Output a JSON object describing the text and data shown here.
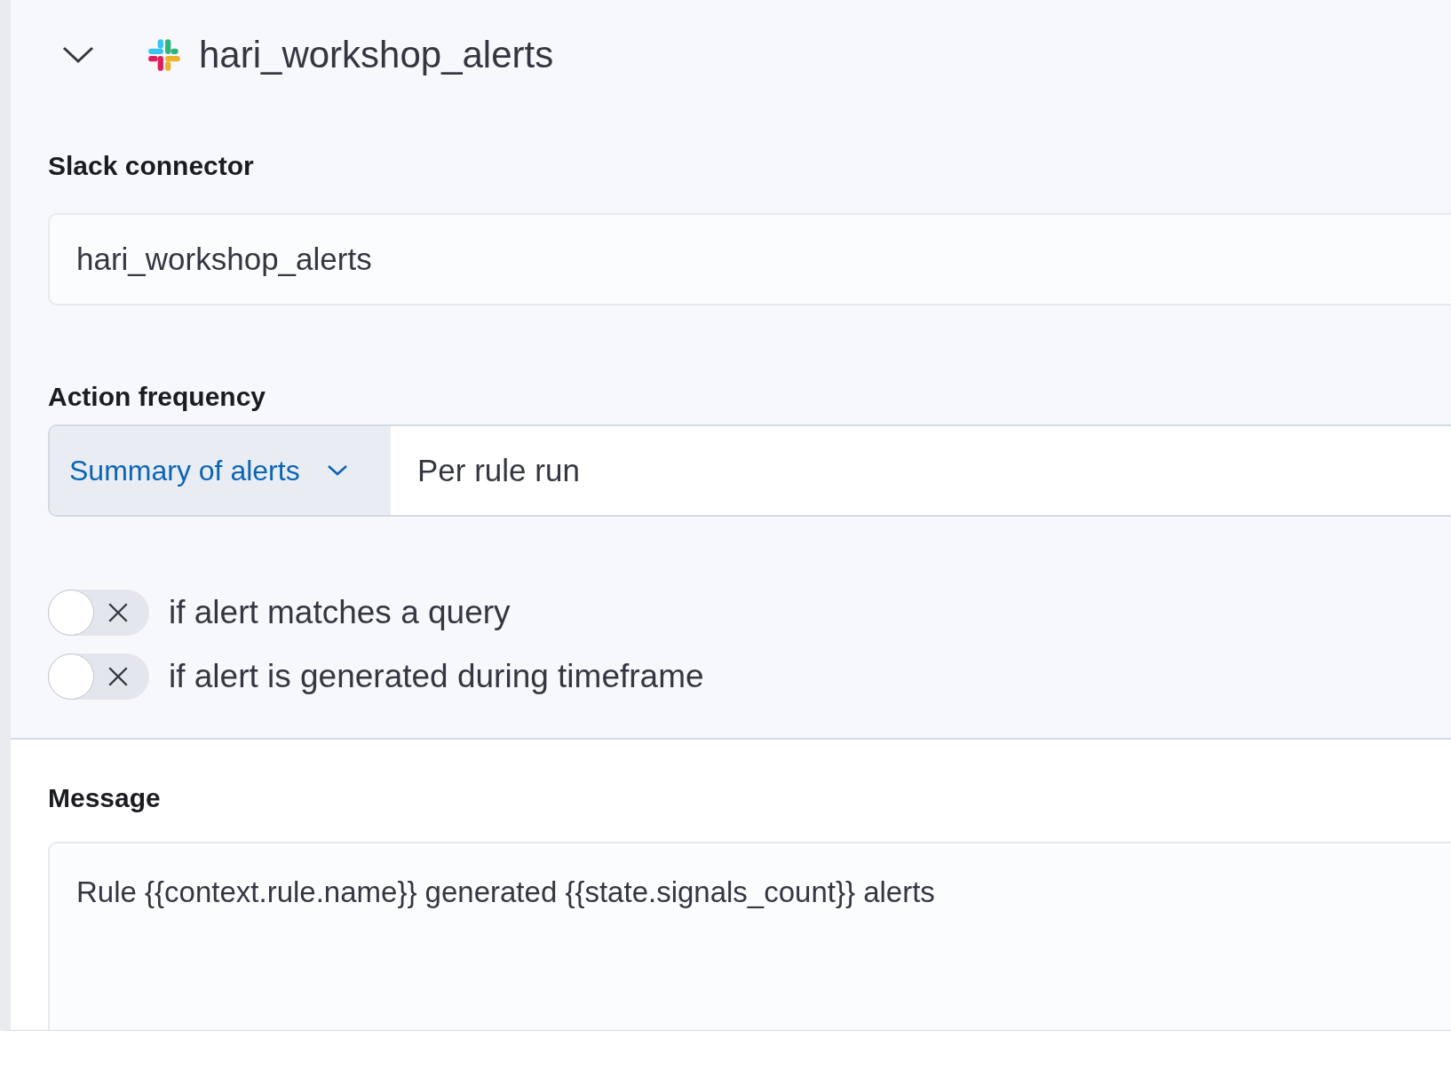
{
  "accordion": {
    "title": "hari_workshop_alerts",
    "expanded": true
  },
  "connector": {
    "label": "Slack connector",
    "value": "hari_workshop_alerts"
  },
  "frequency": {
    "label": "Action frequency",
    "mode": "Summary of alerts",
    "value": "Per rule run"
  },
  "conditions": [
    {
      "label": "if alert matches a query",
      "on": false
    },
    {
      "label": "if alert is generated during timeframe",
      "on": false
    }
  ],
  "message": {
    "label": "Message",
    "value": "Rule {{context.rule.name}} generated {{state.signals_count}} alerts"
  }
}
